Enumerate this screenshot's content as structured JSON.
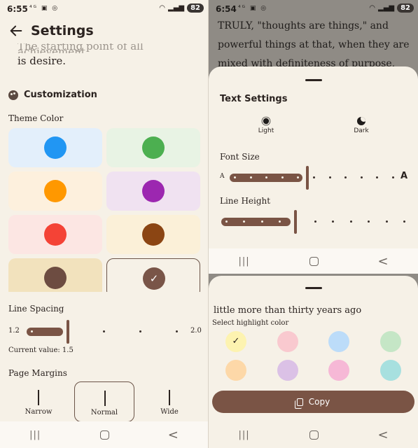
{
  "left": {
    "status": {
      "time": "6:55",
      "battery": "82"
    },
    "appbar": {
      "title": "Settings"
    },
    "quote": {
      "faded_line": "The starting point of all achievement",
      "line": "is desire."
    },
    "customization": {
      "title": "Customization"
    },
    "theme": {
      "label": "Theme Color",
      "swatches": [
        {
          "bg": "#e3effb",
          "dot": "#2196f3"
        },
        {
          "bg": "#e8f3e4",
          "dot": "#4caf50"
        },
        {
          "bg": "#fdf0dd",
          "dot": "#ff9800"
        },
        {
          "bg": "#f0e2f1",
          "dot": "#9c27b0"
        },
        {
          "bg": "#fce6e3",
          "dot": "#f44336"
        },
        {
          "bg": "#fbf0d8",
          "dot": "#8b4513"
        },
        {
          "bg": "#f2e2bd",
          "dot": "#6d4c41"
        },
        {
          "bg": "#f6f1e7",
          "dot": "#795548"
        }
      ],
      "selected_index": 7,
      "check": "✓"
    },
    "line_spacing": {
      "label": "Line Spacing",
      "min": "1.2",
      "max": "2.0",
      "value": 1.5,
      "current": "Current value: 1.5"
    },
    "page_margins": {
      "label": "Page Margins",
      "options": [
        "Narrow",
        "Normal",
        "Wide"
      ],
      "selected": "Normal"
    }
  },
  "right": {
    "status": {
      "time": "6:54",
      "battery": "82"
    },
    "book_text": "TRULY, \"thoughts are things,\" and powerful things at that, when they are mixed with definiteness of purpose, persistence, and a",
    "text_settings": {
      "title": "Text Settings",
      "modes": [
        "Light",
        "Dark"
      ],
      "font_size": {
        "label": "Font Size",
        "min_label": "A",
        "max_label": "A",
        "level": 0.45
      },
      "line_height": {
        "label": "Line Height",
        "level": 0.38
      }
    },
    "highlight": {
      "selected_text": "little more than thirty years ago",
      "label": "Select highlight color",
      "colors": [
        "#fdf3b0",
        "#f9c9cf",
        "#bcdcf9",
        "#c5e6c6",
        "#fdd8a8",
        "#dbc1e6",
        "#f6b8d6",
        "#a7e0df"
      ],
      "selected_index": 0,
      "check": "✓",
      "copy_label": "Copy"
    }
  },
  "nav": {
    "recents": "|||",
    "back": "<"
  }
}
